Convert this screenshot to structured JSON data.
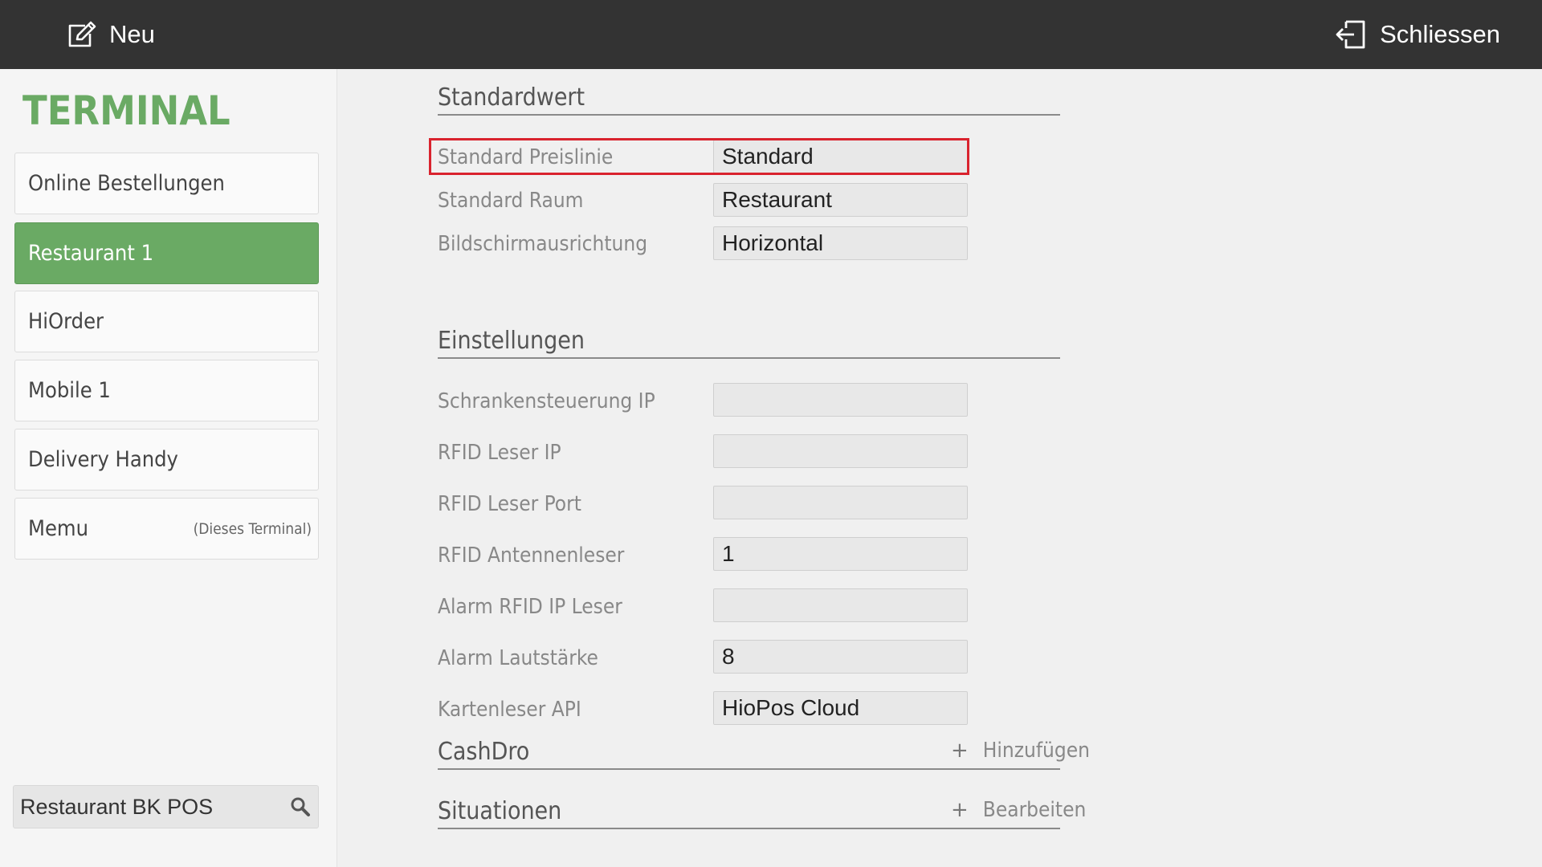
{
  "topbar": {
    "new_label": "Neu",
    "close_label": "Schliessen"
  },
  "sidebar": {
    "title": "TERMINAL",
    "items": [
      {
        "label": "Online Bestellungen",
        "note": ""
      },
      {
        "label": "Restaurant 1",
        "note": "",
        "active": true
      },
      {
        "label": "HiOrder",
        "note": ""
      },
      {
        "label": "Mobile 1",
        "note": ""
      },
      {
        "label": "Delivery Handy",
        "note": ""
      },
      {
        "label": "Memu",
        "note": "(Dieses Terminal)"
      }
    ],
    "search_value": "Restaurant BK POS"
  },
  "standardwert": {
    "title": "Standardwert",
    "rows": [
      {
        "label": "Standard Preislinie",
        "value": "Standard"
      },
      {
        "label": "Standard Raum",
        "value": "Restaurant"
      },
      {
        "label": "Bildschirmausrichtung",
        "value": "Horizontal"
      }
    ]
  },
  "einstellungen": {
    "title": "Einstellungen",
    "rows": [
      {
        "label": "Schrankensteuerung IP",
        "value": ""
      },
      {
        "label": "RFID Leser IP",
        "value": ""
      },
      {
        "label": "RFID Leser Port",
        "value": ""
      },
      {
        "label": "RFID Antennenleser",
        "value": "1"
      },
      {
        "label": "Alarm RFID IP Leser",
        "value": ""
      },
      {
        "label": "Alarm Lautstärke",
        "value": "8"
      },
      {
        "label": "Kartenleser API",
        "value": "HioPos Cloud"
      }
    ]
  },
  "cashdro": {
    "title": "CashDro",
    "action_label": "Hinzufügen"
  },
  "situationen": {
    "title": "Situationen",
    "action_label": "Bearbeiten"
  },
  "colors": {
    "topbar": "#333333",
    "accent_green": "#6aaa64",
    "highlight_red": "#d9232e"
  },
  "icons": {
    "new": "edit-icon",
    "close": "exit-icon",
    "search": "search-icon"
  }
}
